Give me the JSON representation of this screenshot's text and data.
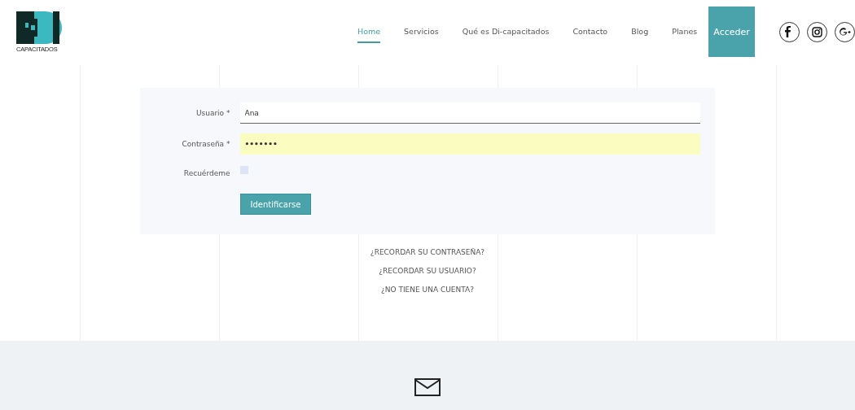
{
  "logo": {
    "caption": "CAPACITADOS"
  },
  "nav": [
    {
      "label": "Home",
      "selected": true
    },
    {
      "label": "Servicios",
      "selected": false
    },
    {
      "label": "Qué es Di-capacitados",
      "selected": false
    },
    {
      "label": "Contacto",
      "selected": false
    },
    {
      "label": "Blog",
      "selected": false
    },
    {
      "label": "Planes",
      "selected": false
    }
  ],
  "access_button": "Acceder",
  "social": [
    {
      "kind": "facebook"
    },
    {
      "kind": "instagram"
    },
    {
      "kind": "googleplus"
    }
  ],
  "form": {
    "fields": [
      {
        "kind": "text",
        "label": "Usuario *",
        "value": "Ana"
      },
      {
        "kind": "password",
        "label": "Contraseña *",
        "value": "•••••••"
      },
      {
        "kind": "checkbox",
        "label": "Recuérdeme",
        "checked": false
      }
    ],
    "submit": "Identificarse"
  },
  "links": [
    "¿RECORDAR SU CONTRASEÑA?",
    "¿RECORDAR SU USUARIO?",
    "¿NO TIENE UNA CUENTA?"
  ]
}
